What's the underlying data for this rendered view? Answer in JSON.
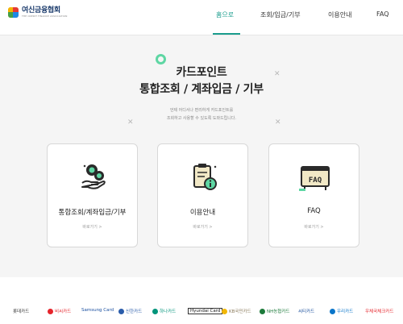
{
  "header": {
    "logo_title": "여신금융협회",
    "logo_sub": "THE CREDIT FINANCE ASSOCIATION",
    "nav": [
      {
        "label": "홈으로",
        "active": true
      },
      {
        "label": "조회/입금/기부",
        "active": false
      },
      {
        "label": "이용안내",
        "active": false
      },
      {
        "label": "FAQ",
        "active": false
      }
    ]
  },
  "hero": {
    "title_line1": "카드포인트",
    "title_line2": "통합조회 / 계좌입금 / 기부",
    "desc_line1": "언제 어디서나 편리하게 카드포인트를",
    "desc_line2": "조회하고 사용할 수 있도록 도와드립니다."
  },
  "cards": [
    {
      "label": "통합조회/계좌입금/기부",
      "link": "바로가기 >",
      "icon": "coin-hand-icon"
    },
    {
      "label": "이용안내",
      "link": "바로가기 >",
      "icon": "clipboard-info-icon"
    },
    {
      "label": "FAQ",
      "link": "바로가기 >",
      "icon": "faq-board-icon"
    }
  ],
  "footer": {
    "banks": [
      {
        "label": "롯데카드",
        "color": "#333333"
      },
      {
        "label": "비씨카드",
        "color": "#e5242b"
      },
      {
        "label": "Samsung Card",
        "color": "#1a4fa0"
      },
      {
        "label": "신한카드",
        "color": "#2a5caa"
      },
      {
        "label": "하나카드",
        "color": "#00947a"
      },
      {
        "label": "Hyundai Card",
        "color": "#111111"
      },
      {
        "label": "KB국민카드",
        "color": "#8a7a5a"
      },
      {
        "label": "NH농협카드",
        "color": "#1c7a3a"
      },
      {
        "label": "씨티카드",
        "color": "#1a4f9c"
      },
      {
        "label": "우리카드",
        "color": "#0a75c9"
      },
      {
        "label": "우체국체크카드",
        "color": "#e5242b"
      }
    ]
  },
  "colors": {
    "accent": "#1a9c8c",
    "deco_ring": "#5ed6a3",
    "background": "#f5f5f5"
  }
}
